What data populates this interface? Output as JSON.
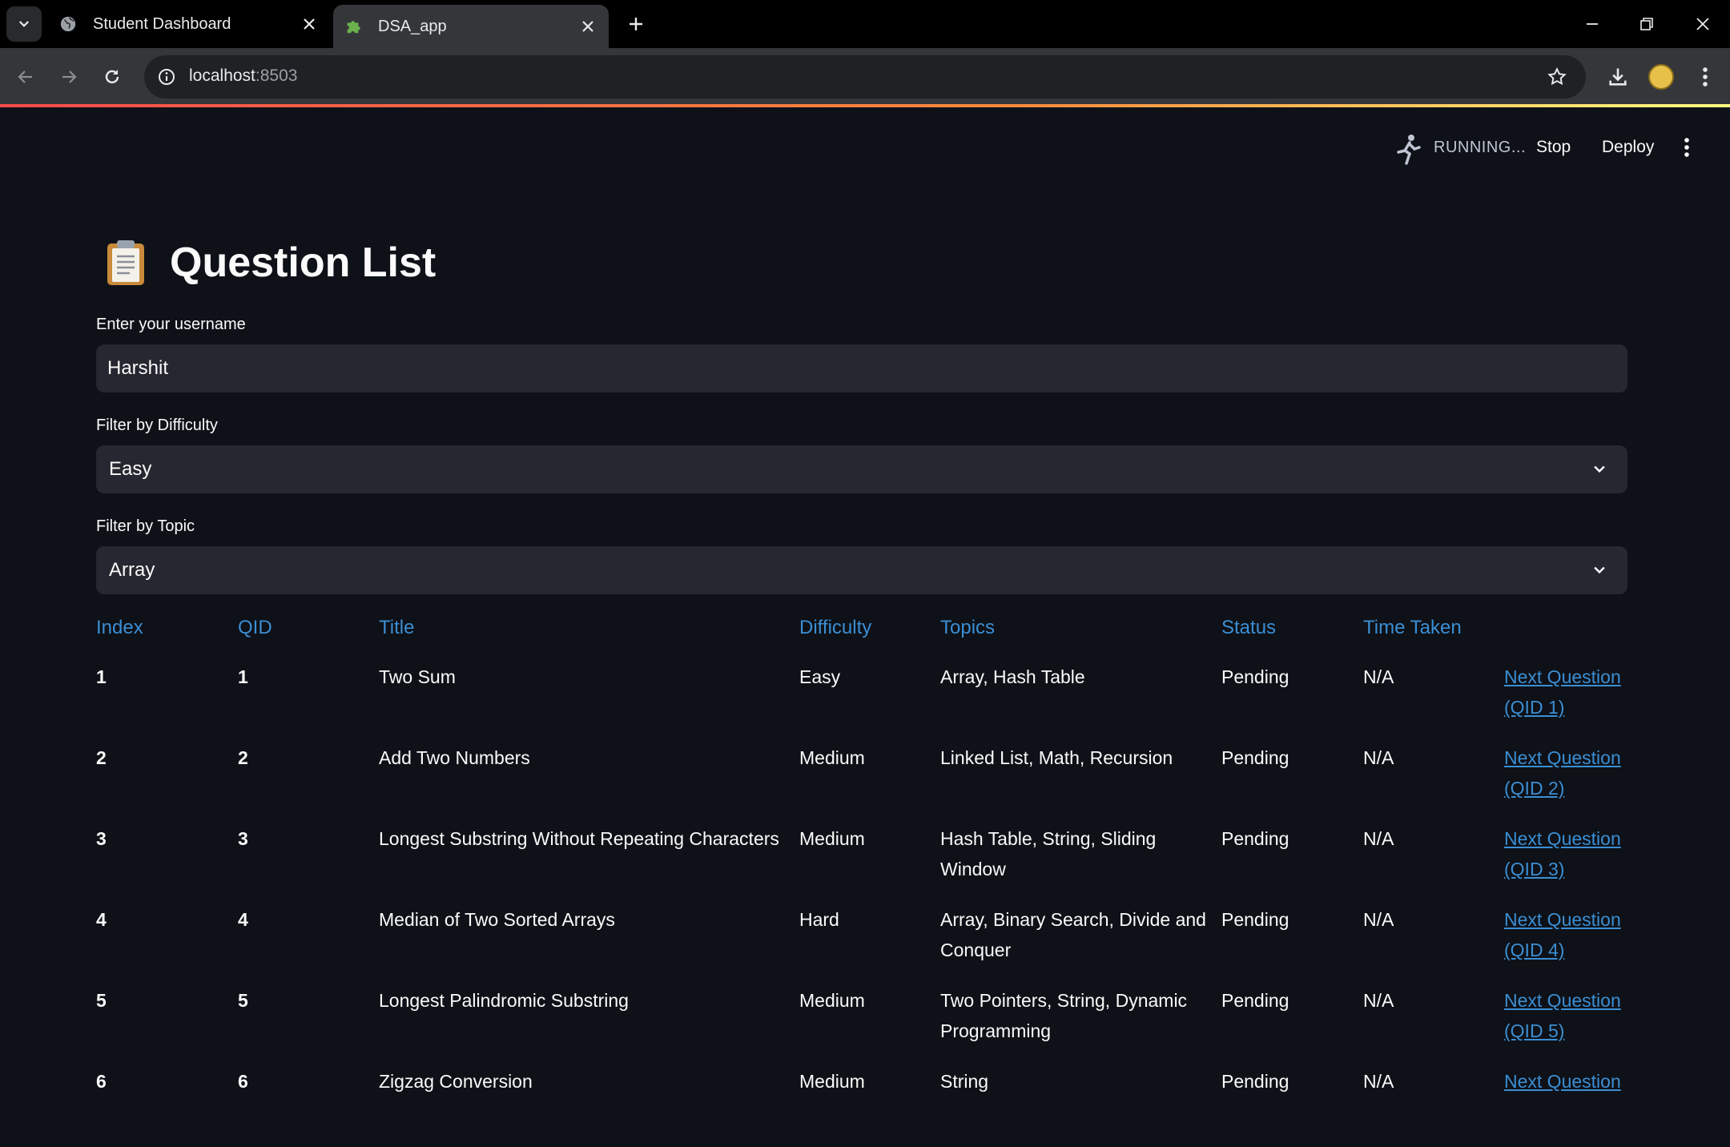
{
  "browser": {
    "tabs": [
      {
        "title": "Student Dashboard",
        "active": false,
        "icon": "globe-icon"
      },
      {
        "title": "DSA_app",
        "active": true,
        "icon": "puzzle-icon"
      }
    ],
    "url_host": "localhost",
    "url_port": ":8503"
  },
  "app_header": {
    "status_text": "RUNNING...",
    "stop_label": "Stop",
    "deploy_label": "Deploy"
  },
  "page": {
    "title": "Question List",
    "title_icon": "clipboard-icon"
  },
  "form": {
    "username_label": "Enter your username",
    "username_value": "Harshit",
    "difficulty_label": "Filter by Difficulty",
    "difficulty_value": "Easy",
    "topic_label": "Filter by Topic",
    "topic_value": "Array"
  },
  "table": {
    "headers": [
      "Index",
      "QID",
      "Title",
      "Difficulty",
      "Topics",
      "Status",
      "Time Taken"
    ],
    "rows": [
      {
        "index": "1",
        "qid": "1",
        "title": "Two Sum",
        "difficulty": "Easy",
        "topics": "Array, Hash Table",
        "status": "Pending",
        "time": "N/A",
        "link": "Next Question (QID 1)"
      },
      {
        "index": "2",
        "qid": "2",
        "title": "Add Two Numbers",
        "difficulty": "Medium",
        "topics": "Linked List, Math, Recursion",
        "status": "Pending",
        "time": "N/A",
        "link": "Next Question (QID 2)"
      },
      {
        "index": "3",
        "qid": "3",
        "title": "Longest Substring Without Repeating Characters",
        "difficulty": "Medium",
        "topics": "Hash Table, String, Sliding Window",
        "status": "Pending",
        "time": "N/A",
        "link": "Next Question (QID 3)"
      },
      {
        "index": "4",
        "qid": "4",
        "title": "Median of Two Sorted Arrays",
        "difficulty": "Hard",
        "topics": "Array, Binary Search, Divide and Conquer",
        "status": "Pending",
        "time": "N/A",
        "link": "Next Question (QID 4)"
      },
      {
        "index": "5",
        "qid": "5",
        "title": "Longest Palindromic Substring",
        "difficulty": "Medium",
        "topics": "Two Pointers, String, Dynamic Programming",
        "status": "Pending",
        "time": "N/A",
        "link": "Next Question (QID 5)"
      },
      {
        "index": "6",
        "qid": "6",
        "title": "Zigzag Conversion",
        "difficulty": "Medium",
        "topics": "String",
        "status": "Pending",
        "time": "N/A",
        "link": "Next Question"
      }
    ]
  },
  "colors": {
    "background": "#0e1117",
    "input_bg": "#262730",
    "accent_blue": "#3b8ed4",
    "text": "#fafafa"
  }
}
